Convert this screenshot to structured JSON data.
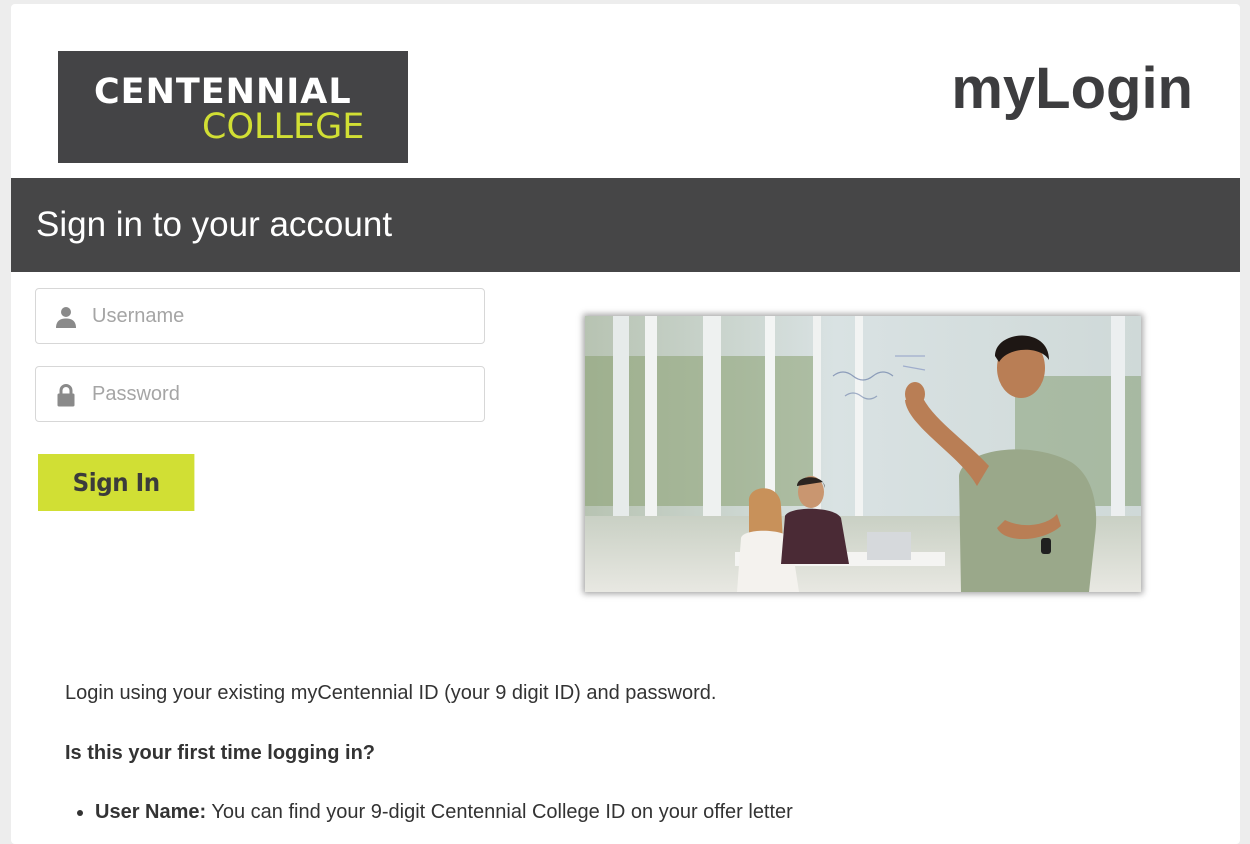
{
  "header": {
    "logo_line1": "CENTENNIAL",
    "logo_line2": "COLLEGE",
    "app_title": "myLogin"
  },
  "banner": {
    "title": "Sign in to your account"
  },
  "form": {
    "username_placeholder": "Username",
    "password_placeholder": "Password",
    "signin_label": "Sign In",
    "username_icon": "user-icon",
    "password_icon": "lock-icon"
  },
  "info": {
    "intro": "Login using your existing myCentennial ID (your 9 digit ID) and password.",
    "question": "Is this your first time logging in?",
    "bullets": [
      {
        "term": "User Name:",
        "text": " You can find your 9-digit Centennial College ID on your offer letter"
      }
    ]
  },
  "colors": {
    "brand_dark": "#464647",
    "brand_lime": "#d1df34",
    "page_bg": "#ededed",
    "text": "#333333"
  }
}
